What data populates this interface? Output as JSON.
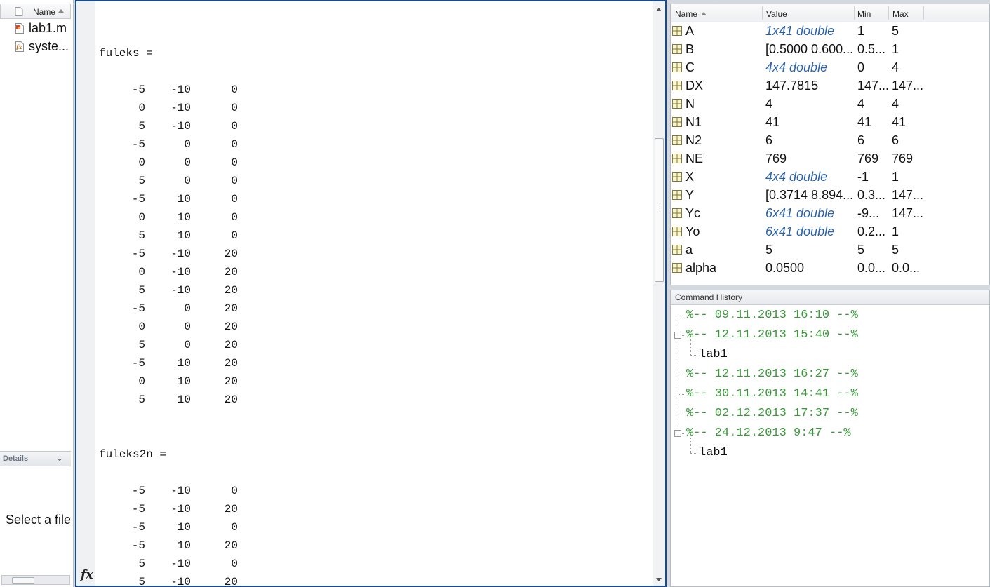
{
  "current_folder": {
    "header": {
      "name_label": "Name"
    },
    "files": [
      {
        "name": "lab1.m",
        "icon": "m-file-icon"
      },
      {
        "name": "syste...",
        "icon": "function-file-icon"
      }
    ],
    "details": {
      "label": "Details",
      "text": "Select a file"
    }
  },
  "command_window": {
    "lines": [
      {
        "kind": "text",
        "text": "fuleks ="
      },
      {
        "kind": "blank"
      },
      {
        "kind": "row",
        "cells": [
          "-5",
          "-10",
          "0"
        ]
      },
      {
        "kind": "row",
        "cells": [
          "0",
          "-10",
          "0"
        ]
      },
      {
        "kind": "row",
        "cells": [
          "5",
          "-10",
          "0"
        ]
      },
      {
        "kind": "row",
        "cells": [
          "-5",
          "0",
          "0"
        ]
      },
      {
        "kind": "row",
        "cells": [
          "0",
          "0",
          "0"
        ]
      },
      {
        "kind": "row",
        "cells": [
          "5",
          "0",
          "0"
        ]
      },
      {
        "kind": "row",
        "cells": [
          "-5",
          "10",
          "0"
        ]
      },
      {
        "kind": "row",
        "cells": [
          "0",
          "10",
          "0"
        ]
      },
      {
        "kind": "row",
        "cells": [
          "5",
          "10",
          "0"
        ]
      },
      {
        "kind": "row",
        "cells": [
          "-5",
          "-10",
          "20"
        ]
      },
      {
        "kind": "row",
        "cells": [
          "0",
          "-10",
          "20"
        ]
      },
      {
        "kind": "row",
        "cells": [
          "5",
          "-10",
          "20"
        ]
      },
      {
        "kind": "row",
        "cells": [
          "-5",
          "0",
          "20"
        ]
      },
      {
        "kind": "row",
        "cells": [
          "0",
          "0",
          "20"
        ]
      },
      {
        "kind": "row",
        "cells": [
          "5",
          "0",
          "20"
        ]
      },
      {
        "kind": "row",
        "cells": [
          "-5",
          "10",
          "20"
        ]
      },
      {
        "kind": "row",
        "cells": [
          "0",
          "10",
          "20"
        ]
      },
      {
        "kind": "row",
        "cells": [
          "5",
          "10",
          "20"
        ]
      },
      {
        "kind": "blank"
      },
      {
        "kind": "blank"
      },
      {
        "kind": "text",
        "text": "fuleks2n ="
      },
      {
        "kind": "blank"
      },
      {
        "kind": "row",
        "cells": [
          "-5",
          "-10",
          "0"
        ]
      },
      {
        "kind": "row",
        "cells": [
          "-5",
          "-10",
          "20"
        ]
      },
      {
        "kind": "row",
        "cells": [
          "-5",
          "10",
          "0"
        ]
      },
      {
        "kind": "row",
        "cells": [
          "-5",
          "10",
          "20"
        ]
      },
      {
        "kind": "row",
        "cells": [
          "5",
          "-10",
          "0"
        ]
      },
      {
        "kind": "row",
        "cells": [
          "5",
          "-10",
          "20"
        ]
      }
    ],
    "prompt_icon": "fx"
  },
  "workspace": {
    "columns": {
      "name": "Name",
      "value": "Value",
      "min": "Min",
      "max": "Max"
    },
    "variables": [
      {
        "name": "A",
        "value": "1x41 double",
        "italic": true,
        "min": "1",
        "max": "5"
      },
      {
        "name": "B",
        "value": "[0.5000 0.600...",
        "italic": false,
        "min": "0.5...",
        "max": "1"
      },
      {
        "name": "C",
        "value": "4x4 double",
        "italic": true,
        "min": "0",
        "max": "4"
      },
      {
        "name": "DX",
        "value": "147.7815",
        "italic": false,
        "min": "147...",
        "max": "147..."
      },
      {
        "name": "N",
        "value": "4",
        "italic": false,
        "min": "4",
        "max": "4"
      },
      {
        "name": "N1",
        "value": "41",
        "italic": false,
        "min": "41",
        "max": "41"
      },
      {
        "name": "N2",
        "value": "6",
        "italic": false,
        "min": "6",
        "max": "6"
      },
      {
        "name": "NE",
        "value": "769",
        "italic": false,
        "min": "769",
        "max": "769"
      },
      {
        "name": "X",
        "value": "4x4 double",
        "italic": true,
        "min": "-1",
        "max": "1"
      },
      {
        "name": "Y",
        "value": "[0.3714 8.894...",
        "italic": false,
        "min": "0.3...",
        "max": "147..."
      },
      {
        "name": "Yc",
        "value": "6x41 double",
        "italic": true,
        "min": "-9...",
        "max": "147..."
      },
      {
        "name": "Yo",
        "value": "6x41 double",
        "italic": true,
        "min": "0.2...",
        "max": "1"
      },
      {
        "name": "a",
        "value": "5",
        "italic": false,
        "min": "5",
        "max": "5"
      },
      {
        "name": "alpha",
        "value": "0.0500",
        "italic": false,
        "min": "0.0...",
        "max": "0.0..."
      }
    ]
  },
  "command_history": {
    "title": "Command History",
    "entries": [
      {
        "kind": "session",
        "text": "%-- 09.11.2013 16:10 --%",
        "expanded": false
      },
      {
        "kind": "session",
        "text": "%-- 12.11.2013 15:40 --%",
        "expanded": true
      },
      {
        "kind": "command",
        "text": "lab1"
      },
      {
        "kind": "session",
        "text": "%-- 12.11.2013 16:27 --%",
        "expanded": false
      },
      {
        "kind": "session",
        "text": "%-- 30.11.2013 14:41 --%",
        "expanded": false
      },
      {
        "kind": "session",
        "text": "%-- 02.12.2013 17:37 --%",
        "expanded": false
      },
      {
        "kind": "session",
        "text": "%-- 24.12.2013 9:47 --%",
        "expanded": true
      },
      {
        "kind": "command",
        "text": "lab1"
      }
    ]
  },
  "colors": {
    "active_border": "#1b4a89",
    "history_session": "#3a9a3a",
    "workspace_italic": "#2c63a8"
  }
}
